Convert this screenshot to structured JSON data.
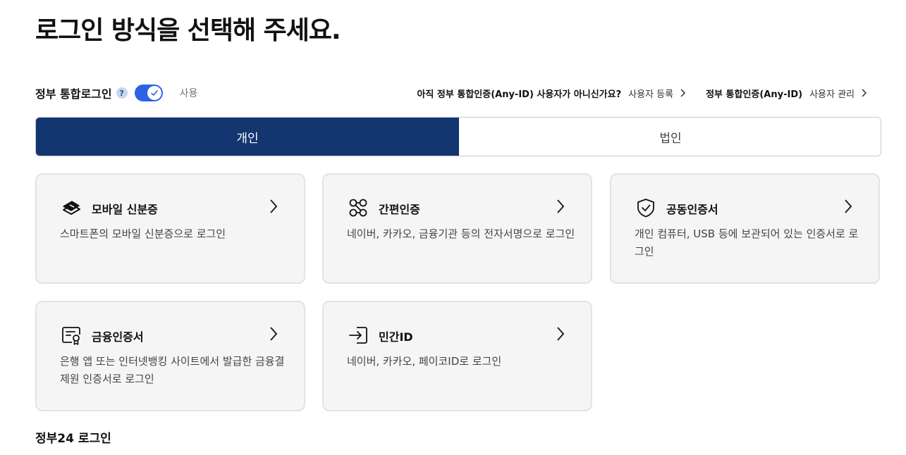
{
  "page": {
    "title": "로그인 방식을 선택해 주세요."
  },
  "integrated_login": {
    "label": "정부 통합로그인",
    "help": "?",
    "toggle_state_label": "사용",
    "question": "아직 정부 통합인증(Any-ID) 사용자가 아니신가요?",
    "register_link": "사용자 등록",
    "gov_auth_label": "정부 통합인증(Any-ID)",
    "manage_link": "사용자 관리"
  },
  "tabs": [
    {
      "label": "개인",
      "active": true
    },
    {
      "label": "법인",
      "active": false
    }
  ],
  "methods": [
    {
      "title": "모바일 신분증",
      "desc": "스마트폰의 모바일 신분증으로 로그인",
      "icon": "mobile-id-icon"
    },
    {
      "title": "간편인증",
      "desc": "네이버, 카카오, 금융기관 등의 전자서명으로 로그인",
      "icon": "simple-auth-icon"
    },
    {
      "title": "공동인증서",
      "desc": "개인 컴퓨터, USB 등에 보관되어 있는 인증서로 로그인",
      "icon": "shield-check-icon"
    },
    {
      "title": "금융인증서",
      "desc": "은행 앱 또는 인터넷뱅킹 사이트에서 발급한 금융결제원 인증서로 로그인",
      "icon": "certificate-icon"
    },
    {
      "title": "민간ID",
      "desc": "네이버, 카카오, 페이코ID로 로그인",
      "icon": "login-arrow-icon"
    }
  ],
  "bottom_section": {
    "title": "정부24 로그인"
  },
  "colors": {
    "primary": "#133570",
    "toggle": "#2d63e0",
    "card_bg": "#f5f5f5"
  }
}
